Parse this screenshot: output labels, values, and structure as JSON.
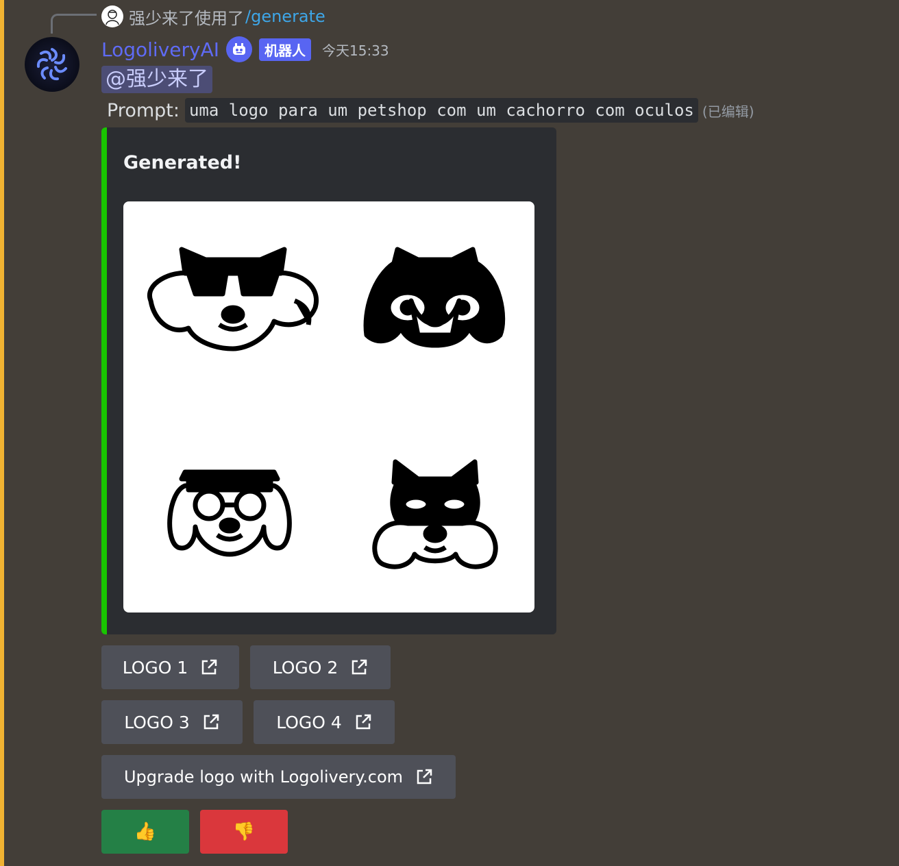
{
  "reply": {
    "user": "强少来了",
    "action": "使用了",
    "command": "/generate"
  },
  "message": {
    "username": "LogoliveryAI",
    "bot_tag": "机器人",
    "timestamp": "今天15:33",
    "mention": "@强少来了",
    "prompt_label": "Prompt:",
    "prompt_text": "uma logo para um petshop com um cachorro com oculos",
    "edited": "(已编辑)"
  },
  "embed": {
    "title": "Generated!",
    "accent_color": "#19c400",
    "image_description_icon": "dog-logos-grid"
  },
  "buttons": {
    "logo1": "LOGO 1",
    "logo2": "LOGO 2",
    "logo3": "LOGO 3",
    "logo4": "LOGO 4",
    "upgrade": "Upgrade logo with Logolivery.com",
    "thumbs_up": "👍",
    "thumbs_down": "👎"
  },
  "colors": {
    "background": "#433e38",
    "mention_bar": "#f0b232",
    "username": "#5f6bf5",
    "bot_tag": "#5865f2",
    "button": "#4e5058",
    "button_green": "#248046",
    "button_red": "#da373c"
  }
}
